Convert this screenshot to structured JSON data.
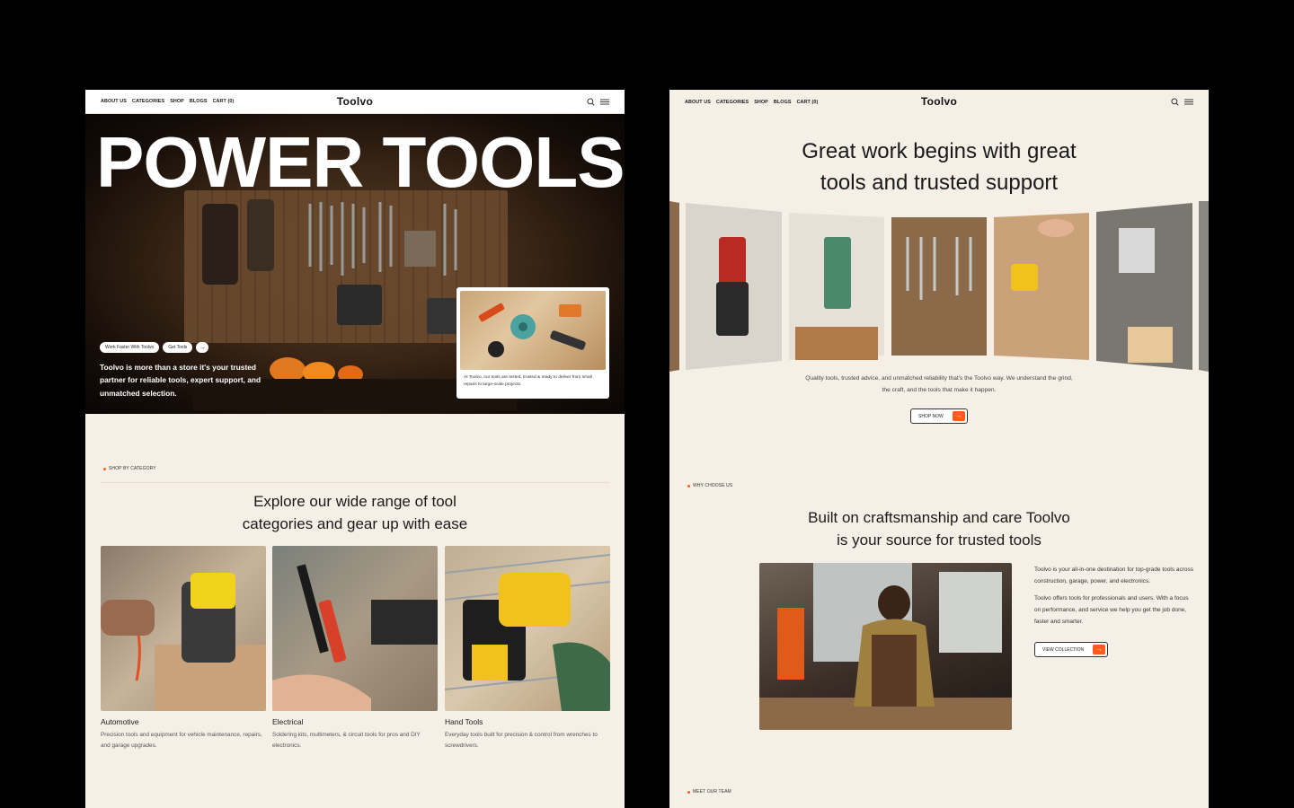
{
  "brand": "Toolvo",
  "nav": {
    "links": [
      "ABOUT US",
      "CATEGORIES",
      "SHOP",
      "BLOGS",
      "CART (0)"
    ]
  },
  "left_page": {
    "hero": {
      "title": "POWER TOOLS",
      "pill_1": "Work Faster With Toolvo",
      "pill_2": "Get Tools",
      "pill_arrow": "→",
      "description": "Toolvo is more than a store it's your trusted partner for reliable tools, expert support, and unmatched selection.",
      "card_text": "At Toolvo, our tools are tested, trusted & ready to deliver from small repairs to large-scale projects."
    },
    "category_section": {
      "tag": "SHOP BY CATEGORY",
      "heading_line1": "Explore our wide range of tool",
      "heading_line2": "categories and gear up with ease",
      "cards": [
        {
          "name": "Automotive",
          "desc": "Precision tools and equipment for vehicle maintenance, repairs, and garage upgrades."
        },
        {
          "name": "Electrical",
          "desc": "Soldering kits, multimeters, & circuit tools for pros and DIY electronics."
        },
        {
          "name": "Hand Tools",
          "desc": "Everyday tools built for precision & control from wrenches to screwdrivers."
        }
      ]
    }
  },
  "right_page": {
    "heading_line1": "Great work begins with great",
    "heading_line2": "tools and trusted support",
    "copy": "Quality tools, trusted advice, and unmatched reliability that's the Toolvo way. We understand the grind, the craft, and the tools that make it happen.",
    "shop_button": "SHOP NOW",
    "arrow": "→",
    "why": {
      "tag": "WHY CHOOSE US",
      "heading_line1": "Built on craftsmanship and care Toolvo",
      "heading_line2": "is your source for trusted tools",
      "para1": "Toolvo is your all-in-one destination for top-grade tools across construction, garage, power, and electronics.",
      "para2": "Toolvo offers tools for professionals and users. With a focus on performance, and service we help you get the job done, faster and smarter.",
      "button": "VIEW COLLECTION"
    },
    "team_tag": "MEET OUR TEAM"
  },
  "colors": {
    "accent": "#ff5a1f",
    "page_bg": "#f6efe6",
    "outer_bg": "#000000"
  }
}
